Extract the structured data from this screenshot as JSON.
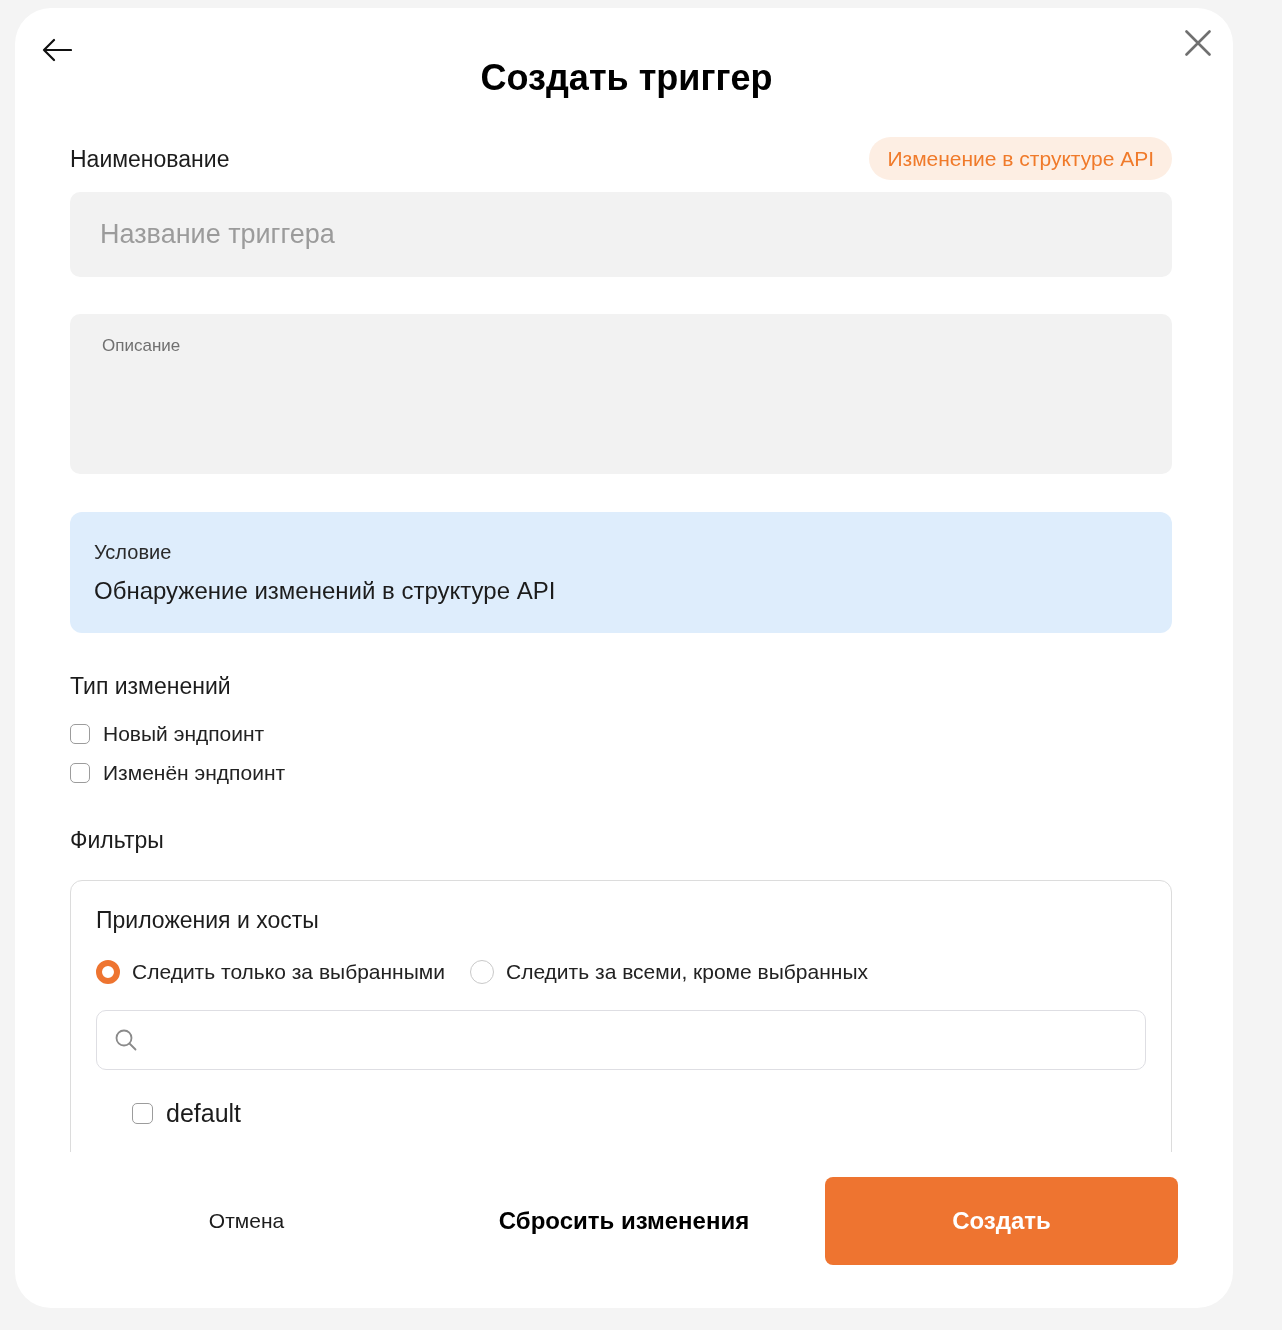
{
  "header": {
    "title": "Создать триггер"
  },
  "name_field": {
    "label": "Наименование",
    "badge": "Изменение в структуре API",
    "placeholder": "Название триггера"
  },
  "description_field": {
    "placeholder": "Описание"
  },
  "condition": {
    "label": "Условие",
    "value": "Обнаружение изменений в структуре API"
  },
  "change_types": {
    "title": "Тип изменений",
    "options": [
      {
        "label": "Новый эндпоинт",
        "checked": false
      },
      {
        "label": "Изменён эндпоинт",
        "checked": false
      }
    ]
  },
  "filters": {
    "title": "Фильтры",
    "card": {
      "title": "Приложения и хосты",
      "modes": [
        {
          "label": "Следить только за выбранными",
          "selected": true
        },
        {
          "label": "Следить за всеми, кроме выбранных",
          "selected": false
        }
      ],
      "items": [
        {
          "label": "default",
          "checked": false
        }
      ]
    }
  },
  "footer": {
    "buttons": [
      {
        "label": "Отмена",
        "kind": "text"
      },
      {
        "label": "Сбросить изменения",
        "kind": "secondary"
      },
      {
        "label": "Создать",
        "kind": "primary"
      }
    ]
  }
}
